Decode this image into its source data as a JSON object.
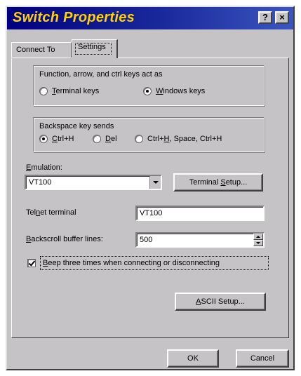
{
  "window": {
    "title": "Switch Properties",
    "help_label": "?",
    "close_label": "×"
  },
  "tabs": [
    {
      "label": "Connect To",
      "active": false
    },
    {
      "label": "Settings",
      "active": true
    }
  ],
  "function_keys": {
    "label": "Function, arrow, and ctrl keys act as",
    "options": [
      {
        "underline": "T",
        "rest": "erminal keys",
        "checked": false
      },
      {
        "underline": "W",
        "rest": "indows keys",
        "checked": true
      }
    ]
  },
  "backspace": {
    "label": "Backspace key sends",
    "options": [
      {
        "prefix": "",
        "underline": "C",
        "rest": "trl+H",
        "checked": true
      },
      {
        "prefix": "",
        "underline": "D",
        "rest": "el",
        "checked": false
      },
      {
        "prefix": "Ctrl+",
        "underline": "H",
        "rest": ", Space, Ctrl+H",
        "checked": false
      }
    ]
  },
  "emulation": {
    "label_underline": "E",
    "label_rest": "mulation:",
    "value": "VT100",
    "setup_button_prefix": "Terminal ",
    "setup_button_underline": "S",
    "setup_button_rest": "etup..."
  },
  "telnet": {
    "label_prefix": "Tel",
    "label_underline": "n",
    "label_rest": "et terminal",
    "value": "VT100"
  },
  "backscroll": {
    "label_underline": "B",
    "label_rest": "ackscroll buffer lines:",
    "value": "500"
  },
  "beep": {
    "label_prefix": "",
    "label_underline": "B",
    "label_rest": "eep three times when connecting or disconnecting",
    "checked": true
  },
  "ascii_setup": {
    "prefix": "",
    "underline": "A",
    "rest": "SCII Setup..."
  },
  "footer": {
    "ok_label": "OK",
    "cancel_label": "Cancel"
  },
  "colors": {
    "face": "#c6c3c6",
    "title_start": "#000080",
    "title_text": "#ffd200"
  }
}
